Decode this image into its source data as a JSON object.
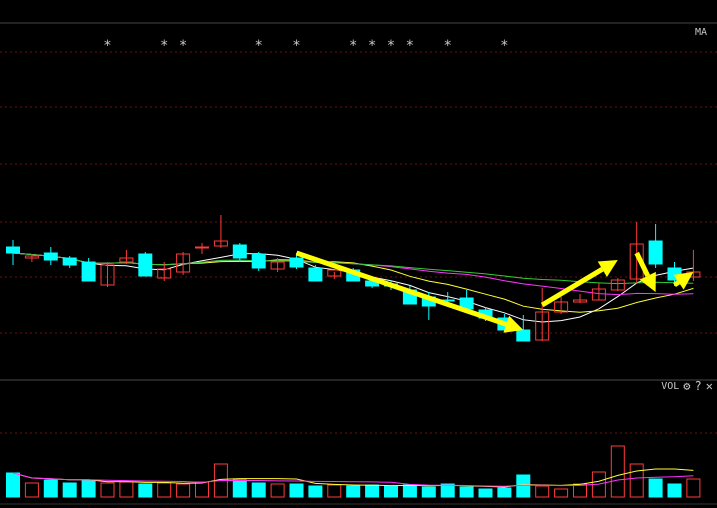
{
  "chart_data": {
    "type": "candlestick",
    "price_panel": {
      "indicator_label": "MA",
      "star_marker": "*",
      "colors": {
        "up": "#ff3b3b",
        "down": "#00ffff",
        "ma_white": "#ffffff",
        "ma_yellow": "#ffff33",
        "ma_magenta": "#ff33ff",
        "ma_green": "#33cc33",
        "arrow": "#ffff00",
        "grid": "#6b0f0f"
      },
      "candles": [
        {
          "o": 247,
          "h": 240,
          "l": 265,
          "c": 253
        },
        {
          "o": 258,
          "h": 254,
          "l": 262,
          "c": 256
        },
        {
          "o": 253,
          "h": 247,
          "l": 265,
          "c": 260
        },
        {
          "o": 258,
          "h": 256,
          "l": 268,
          "c": 265
        },
        {
          "o": 262,
          "h": 258,
          "l": 281,
          "c": 281
        },
        {
          "o": 285,
          "h": 262,
          "l": 287,
          "c": 265
        },
        {
          "o": 262,
          "h": 250,
          "l": 264,
          "c": 258
        },
        {
          "o": 254,
          "h": 252,
          "l": 276,
          "c": 276
        },
        {
          "o": 278,
          "h": 262,
          "l": 281,
          "c": 269
        },
        {
          "o": 272,
          "h": 252,
          "l": 275,
          "c": 254
        },
        {
          "o": 248,
          "h": 243,
          "l": 254,
          "c": 247
        },
        {
          "o": 246,
          "h": 215,
          "l": 248,
          "c": 241
        },
        {
          "o": 245,
          "h": 243,
          "l": 262,
          "c": 258
        },
        {
          "o": 254,
          "h": 252,
          "l": 271,
          "c": 268
        },
        {
          "o": 269,
          "h": 258,
          "l": 272,
          "c": 262
        },
        {
          "o": 258,
          "h": 253,
          "l": 269,
          "c": 267
        },
        {
          "o": 268,
          "h": 265,
          "l": 281,
          "c": 281
        },
        {
          "o": 276,
          "h": 272,
          "l": 279,
          "c": 270
        },
        {
          "o": 270,
          "h": 268,
          "l": 281,
          "c": 281
        },
        {
          "o": 281,
          "h": 279,
          "l": 288,
          "c": 286
        },
        {
          "o": 284,
          "h": 280,
          "l": 290,
          "c": 286
        },
        {
          "o": 290,
          "h": 286,
          "l": 304,
          "c": 304
        },
        {
          "o": 297,
          "h": 292,
          "l": 320,
          "c": 306
        },
        {
          "o": 300,
          "h": 292,
          "l": 302,
          "c": 301
        },
        {
          "o": 298,
          "h": 290,
          "l": 310,
          "c": 309
        },
        {
          "o": 310,
          "h": 307,
          "l": 321,
          "c": 318
        },
        {
          "o": 318,
          "h": 314,
          "l": 329,
          "c": 330
        },
        {
          "o": 330,
          "h": 315,
          "l": 341,
          "c": 341
        },
        {
          "o": 340,
          "h": 288,
          "l": 341,
          "c": 312
        },
        {
          "o": 312,
          "h": 297,
          "l": 314,
          "c": 302
        },
        {
          "o": 302,
          "h": 294,
          "l": 303,
          "c": 300
        },
        {
          "o": 300,
          "h": 283,
          "l": 300,
          "c": 289
        },
        {
          "o": 290,
          "h": 278,
          "l": 291,
          "c": 280
        },
        {
          "o": 279,
          "h": 222,
          "l": 283,
          "c": 244
        },
        {
          "o": 241,
          "h": 224,
          "l": 268,
          "c": 264
        },
        {
          "o": 268,
          "h": 262,
          "l": 286,
          "c": 280
        },
        {
          "o": 277,
          "h": 250,
          "l": 281,
          "c": 272
        }
      ],
      "stars_at": [
        5,
        8,
        9,
        13,
        15,
        18,
        19,
        20,
        21,
        23,
        26
      ]
    },
    "volume_panel": {
      "label": "VOL",
      "volumes": [
        473,
        483,
        480,
        483,
        480,
        483,
        482,
        484,
        483,
        484,
        482,
        464,
        480,
        483,
        484,
        484,
        486,
        485,
        486,
        485,
        486,
        485,
        487,
        484,
        487,
        489,
        488,
        475,
        486,
        489,
        484,
        472,
        446,
        464,
        479,
        484,
        479
      ]
    }
  }
}
